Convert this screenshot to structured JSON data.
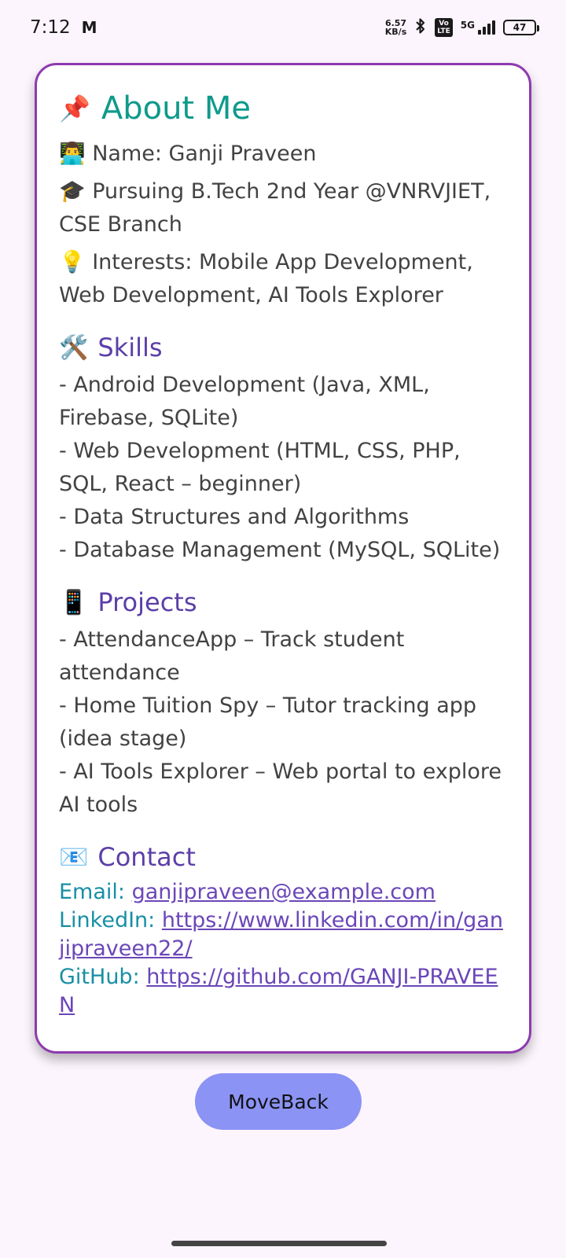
{
  "status_bar": {
    "time": "7:12",
    "app_icon": "M",
    "net_speed_value": "6.57",
    "net_speed_unit": "KB/s",
    "volte": "Vo\nLTE",
    "network": "5G",
    "battery": "47"
  },
  "about": {
    "title": "About Me",
    "title_icon": "📌",
    "name_icon": "👨‍💻",
    "name": "Name: Ganji Praveen",
    "edu_icon": "🎓",
    "education": "Pursuing B.Tech 2nd Year @VNRVJIET, CSE Branch",
    "interests_icon": "💡",
    "interests": "Interests: Mobile App Development, Web Development, AI Tools Explorer"
  },
  "skills": {
    "title": "Skills",
    "icon": "🛠️",
    "items": [
      "- Android Development (Java, XML, Firebase, SQLite)",
      "- Web Development (HTML, CSS, PHP, SQL, React – beginner)",
      "- Data Structures and Algorithms",
      "- Database Management (MySQL, SQLite)"
    ]
  },
  "projects": {
    "title": "Projects",
    "icon": "📱",
    "items": [
      "- AttendanceApp – Track student attendance",
      "- Home Tuition Spy – Tutor tracking app (idea stage)",
      "- AI Tools Explorer – Web portal to explore AI tools"
    ]
  },
  "contact": {
    "title": "Contact",
    "icon": "📧",
    "email_label": "Email: ",
    "email": "ganjipraveen@example.com",
    "linkedin_label": "LinkedIn: ",
    "linkedin": "https://www.linkedin.com/in/ganjipraveen22/",
    "github_label": "GitHub: ",
    "github": "https://github.com/GANJI-PRAVEEN"
  },
  "button": {
    "label": "MoveBack"
  },
  "colors": {
    "accent_teal": "#0e9a8b",
    "accent_purple": "#5b3fa8",
    "card_border": "#8e3ab0",
    "button_bg": "#8b93f5"
  }
}
